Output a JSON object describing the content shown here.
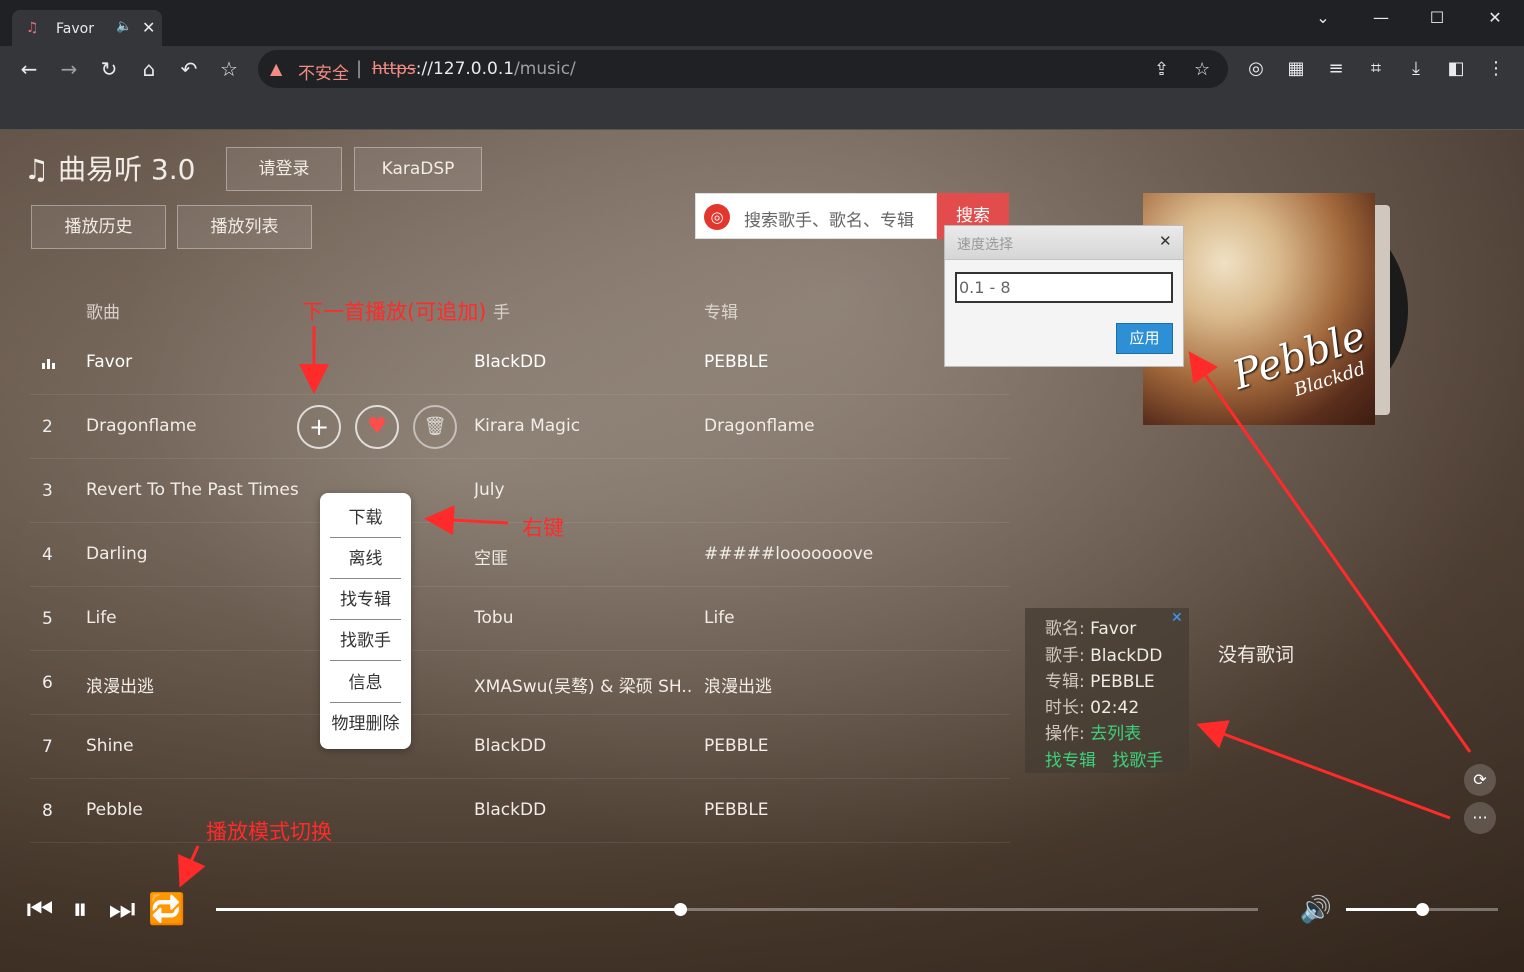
{
  "browser": {
    "tab_title": "Favor",
    "url_warning": "不安全",
    "url_scheme": "https",
    "url_host": "://127.0.0.1",
    "url_path": "/music/"
  },
  "app": {
    "title": "曲易听 3.0",
    "login_label": "请登录",
    "karadsp_label": "KaraDSP",
    "history_label": "播放历史",
    "playlist_label": "播放列表",
    "search_placeholder": "搜索歌手、歌名、专辑",
    "search_button": "搜索"
  },
  "table": {
    "col_song": "歌曲",
    "col_artist_visible": "手",
    "col_album": "专辑",
    "rows": [
      {
        "num": "",
        "name": "Favor",
        "artist": "BlackDD",
        "album": "PEBBLE",
        "playing": true
      },
      {
        "num": "2",
        "name": "Dragonflame",
        "artist": "Kirara Magic",
        "album": "Dragonflame"
      },
      {
        "num": "3",
        "name": "Revert To The Past Times",
        "artist": "July",
        "album": ""
      },
      {
        "num": "4",
        "name": "Darling",
        "artist": "空匪",
        "album": "#####looooooove"
      },
      {
        "num": "5",
        "name": "Life",
        "artist": "Tobu",
        "album": "Life"
      },
      {
        "num": "6",
        "name": "浪漫出逃",
        "artist": "XMASwu(吴骜) & 梁硕 SH...",
        "album": "浪漫出逃"
      },
      {
        "num": "7",
        "name": "Shine",
        "artist": "BlackDD",
        "album": "PEBBLE"
      },
      {
        "num": "8",
        "name": "Pebble",
        "artist": "BlackDD",
        "album": "PEBBLE"
      }
    ]
  },
  "context_menu": {
    "items": [
      "下载",
      "离线",
      "找专辑",
      "找歌手",
      "信息",
      "物理删除"
    ]
  },
  "speed_dialog": {
    "title": "速度选择",
    "input_value": "0.1 - 8",
    "apply_label": "应用"
  },
  "cover": {
    "title": "Pebble",
    "subtitle": "Blackdd"
  },
  "info_panel": {
    "name_key": "歌名:",
    "name_val": "Favor",
    "artist_key": "歌手:",
    "artist_val": "BlackDD",
    "album_key": "专辑:",
    "album_val": "PEBBLE",
    "duration_key": "时长:",
    "duration_val": "02:42",
    "op_key": "操作:",
    "op_to_list": "去列表",
    "op_find_album": "找专辑",
    "op_find_artist": "找歌手"
  },
  "no_lyrics": "没有歌词",
  "annotations": {
    "next_play": "下一首播放(可追加)",
    "right_click": "右键",
    "play_mode": "播放模式切换"
  },
  "player": {
    "progress": 0.445,
    "volume": 0.5
  },
  "colors": {
    "accent_red": "#e24c4c",
    "annotation_red": "#ff2b2b",
    "link_green": "#3dd07a",
    "dialog_blue": "#2d8fd5"
  }
}
